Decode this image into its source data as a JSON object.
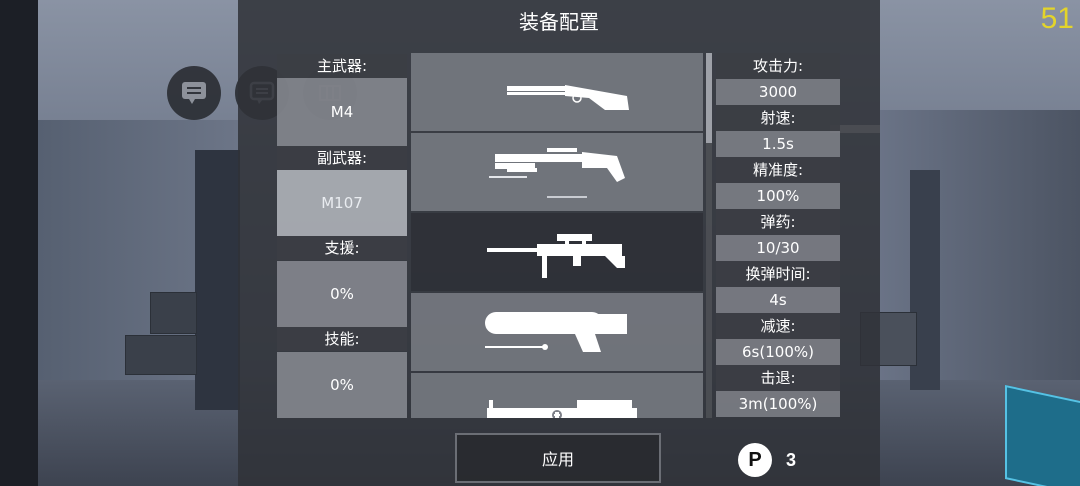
{
  "fps": "51",
  "dialog": {
    "title": "装备配置",
    "apply_label": "应用",
    "points": {
      "icon_letter": "P",
      "count": "3"
    }
  },
  "slots": [
    {
      "label": "主武器:",
      "value": "M4"
    },
    {
      "label": "副武器:",
      "value": "M107"
    },
    {
      "label": "支援:",
      "value": "0%"
    },
    {
      "label": "技能:",
      "value": "0%"
    }
  ],
  "weapons": [
    {
      "icon": "double-barrel-shotgun-icon"
    },
    {
      "icon": "pump-shotgun-icon"
    },
    {
      "icon": "sniper-rifle-icon"
    },
    {
      "icon": "plasma-rifle-icon"
    },
    {
      "icon": "heavy-cannon-icon"
    }
  ],
  "selected_weapon_index": 2,
  "stats": [
    {
      "label": "攻击力:",
      "value": "3000"
    },
    {
      "label": "射速:",
      "value": "1.5s"
    },
    {
      "label": "精准度:",
      "value": "100%"
    },
    {
      "label": "弹药:",
      "value": "10/30"
    },
    {
      "label": "换弹时间:",
      "value": "4s"
    },
    {
      "label": "减速:",
      "value": "6s(100%)"
    },
    {
      "label": "击退:",
      "value": "3m(100%)"
    }
  ],
  "hud_icons": [
    "chat-bubble-icon",
    "chat-outline-icon",
    "map-icon"
  ],
  "colors": {
    "fps": "#e3d42a",
    "panel": "#303238",
    "accent_cyan": "#56c2e4"
  }
}
